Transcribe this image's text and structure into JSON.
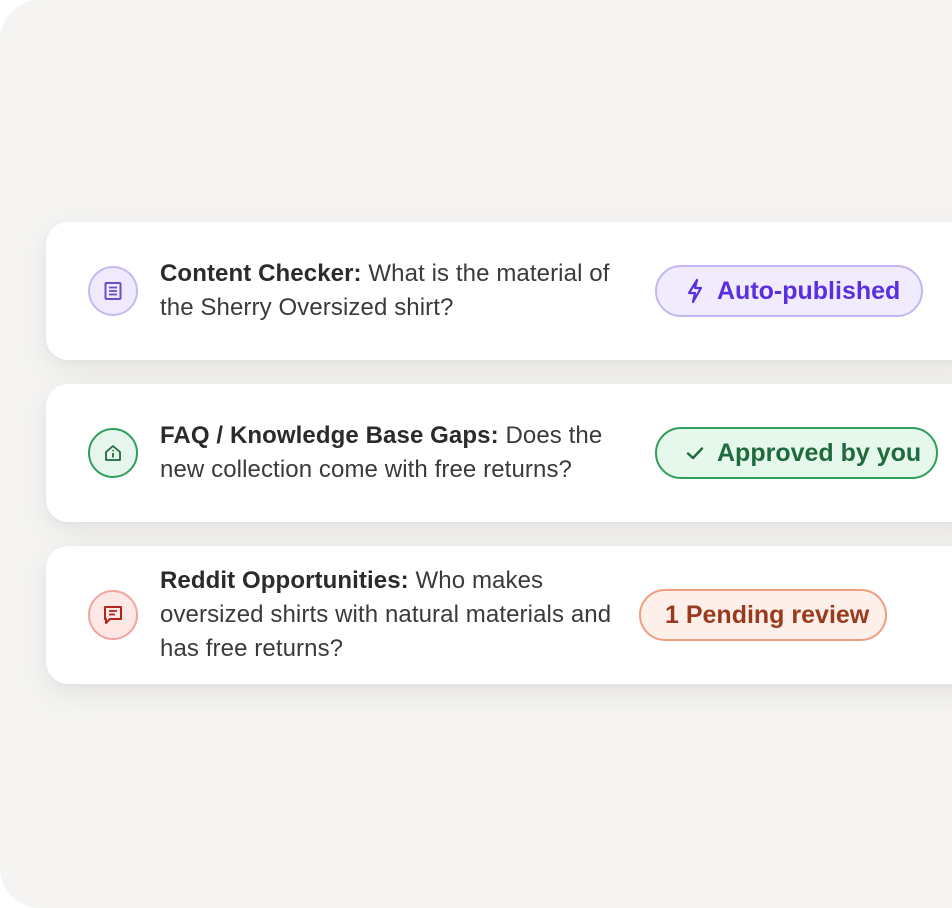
{
  "items": [
    {
      "title": "Content Checker:",
      "description": "What is the material of the Sherry Oversized shirt?",
      "icon": "document-icon",
      "status": {
        "label": "Auto-published",
        "icon": "lightning-icon",
        "color": "#5b2ee0"
      }
    },
    {
      "title": "FAQ / Knowledge Base Gaps:",
      "description": "Does the new collection come with free returns?",
      "icon": "info-home-icon",
      "status": {
        "label": "Approved by you",
        "icon": "checkmark-icon",
        "color": "#1e6b3c"
      }
    },
    {
      "title": "Reddit Opportunities:",
      "description": "Who makes oversized shirts with natural materials and has free returns?",
      "icon": "chat-icon",
      "status": {
        "label": "1 Pending review",
        "icon": "",
        "color": "#9a3a1c"
      }
    }
  ]
}
